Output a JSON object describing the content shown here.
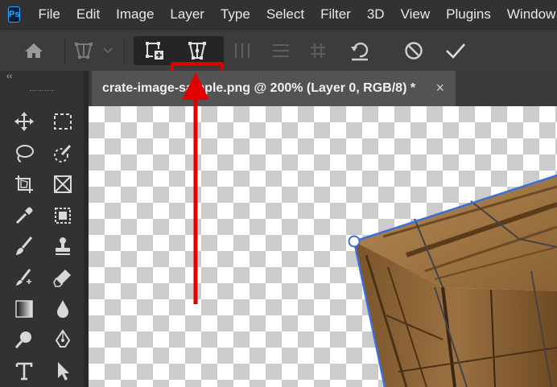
{
  "app": {
    "logo_text": "Ps"
  },
  "menu": [
    "File",
    "Edit",
    "Image",
    "Layer",
    "Type",
    "Select",
    "Filter",
    "3D",
    "View",
    "Plugins",
    "Window"
  ],
  "options_bar": {
    "icons": [
      "home-icon",
      "warp-mode-icon",
      "chevron-down-icon",
      "split-warp-icon",
      "warp-grid-icon",
      "vertical-split-icon",
      "horizontal-split-icon",
      "cross-split-icon",
      "reset-warp-icon",
      "cancel-icon",
      "commit-icon"
    ],
    "highlighted": "warp-grid-icon"
  },
  "toolbar": {
    "collapse_glyph": "‹‹",
    "tools": [
      "move-tool",
      "marquee-tool",
      "lasso-tool",
      "quick-selection-tool",
      "crop-tool",
      "frame-tool",
      "eyedropper-tool",
      "object-selection-tool",
      "brush-tool",
      "clone-stamp-tool",
      "healing-brush-tool",
      "eraser-tool",
      "gradient-tool",
      "blur-tool",
      "dodge-tool",
      "pen-tool",
      "type-tool",
      "path-selection-tool"
    ]
  },
  "document": {
    "tab_title": "crate-image-sample.png @ 200% (Layer 0, RGB/8) *",
    "close_glyph": "×"
  },
  "colors": {
    "menubar": "#323232",
    "optionsbar": "#3c3c3c",
    "highlight": "#e00000",
    "transform_outline": "#3b6fd9"
  }
}
